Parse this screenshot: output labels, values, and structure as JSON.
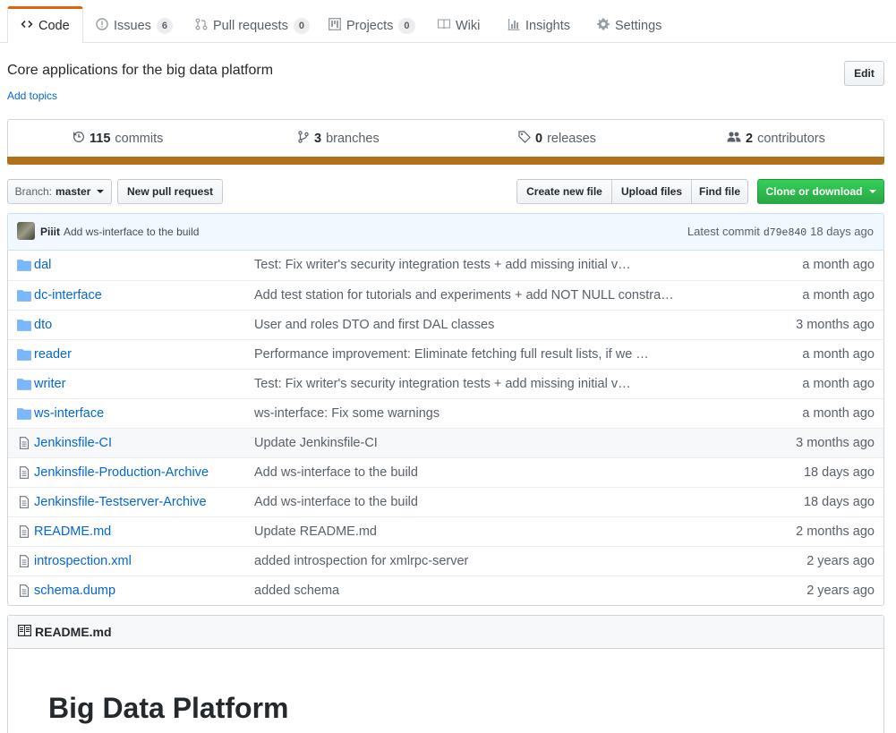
{
  "tabs": [
    {
      "label": "Code",
      "icon": "code-icon",
      "selected": true
    },
    {
      "label": "Issues",
      "icon": "issue-icon",
      "count": "6"
    },
    {
      "label": "Pull requests",
      "icon": "pull-request-icon",
      "count": "0"
    },
    {
      "label": "Projects",
      "icon": "project-icon",
      "count": "0"
    },
    {
      "label": "Wiki",
      "icon": "book-icon"
    },
    {
      "label": "Insights",
      "icon": "graph-icon"
    },
    {
      "label": "Settings",
      "icon": "gear-icon"
    }
  ],
  "repo": {
    "description": "Core applications for the big data platform",
    "add_topics": "Add topics",
    "edit_label": "Edit"
  },
  "summary": {
    "commits": {
      "count": "115",
      "label": "commits"
    },
    "branches": {
      "count": "3",
      "label": "branches"
    },
    "releases": {
      "count": "0",
      "label": "releases"
    },
    "contributors": {
      "count": "2",
      "label": "contributors"
    },
    "language_color": "#b07219"
  },
  "actions": {
    "branch_prefix": "Branch:",
    "branch_name": "master",
    "new_pr": "New pull request",
    "create_file": "Create new file",
    "upload_files": "Upload files",
    "find_file": "Find file",
    "clone": "Clone or download"
  },
  "latest_commit": {
    "author": "Piiit",
    "message": "Add ws-interface to the build",
    "prefix": "Latest commit",
    "sha": "d79e840",
    "age": "18 days ago"
  },
  "files": [
    {
      "type": "dir",
      "name": "dal",
      "message": "Test: Fix writer's security integration tests + add missing initial v…",
      "age": "a month ago"
    },
    {
      "type": "dir",
      "name": "dc-interface",
      "message": "Add test station for tutorials and experiments + add NOT NULL constra…",
      "age": "a month ago"
    },
    {
      "type": "dir",
      "name": "dto",
      "message": "User and roles DTO and first DAL classes",
      "age": "3 months ago"
    },
    {
      "type": "dir",
      "name": "reader",
      "message": "Performance improvement: Eliminate fetching full result lists, if we …",
      "age": "a month ago"
    },
    {
      "type": "dir",
      "name": "writer",
      "message": "Test: Fix writer's security integration tests + add missing initial v…",
      "age": "a month ago"
    },
    {
      "type": "dir",
      "name": "ws-interface",
      "message": "ws-interface: Fix some warnings",
      "age": "a month ago"
    },
    {
      "type": "file",
      "name": "Jenkinsfile-CI",
      "message": "Update Jenkinsfile-CI",
      "age": "3 months ago"
    },
    {
      "type": "file",
      "name": "Jenkinsfile-Production-Archive",
      "message": "Add ws-interface to the build",
      "age": "18 days ago"
    },
    {
      "type": "file",
      "name": "Jenkinsfile-Testserver-Archive",
      "message": "Add ws-interface to the build",
      "age": "18 days ago"
    },
    {
      "type": "file",
      "name": "README.md",
      "message": "Update README.md",
      "age": "2 months ago"
    },
    {
      "type": "file",
      "name": "introspection.xml",
      "message": "added introspection for xmlrpc-server",
      "age": "2 years ago"
    },
    {
      "type": "file",
      "name": "schema.dump",
      "message": "added schema",
      "age": "2 years ago"
    }
  ],
  "readme": {
    "filename": "README.md",
    "heading": "Big Data Platform"
  }
}
